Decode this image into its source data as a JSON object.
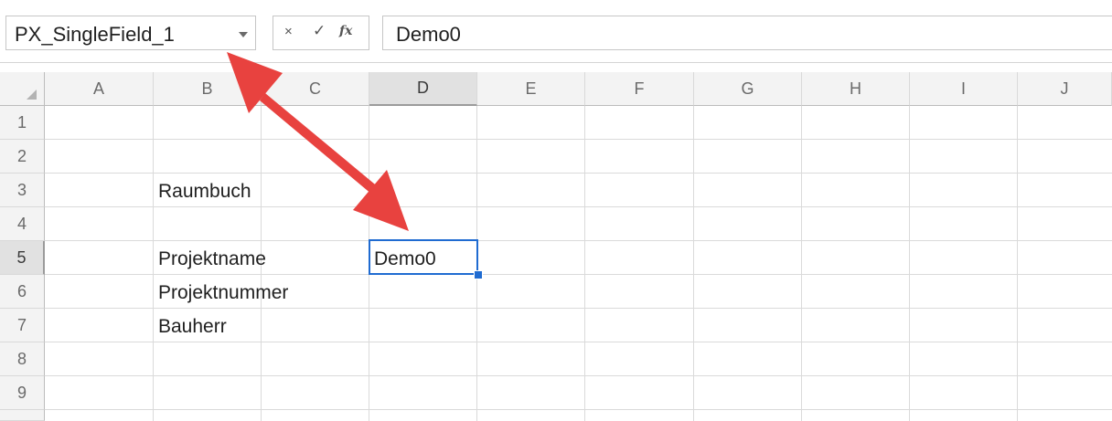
{
  "name_box": {
    "value": "PX_SingleField_1"
  },
  "formula_bar": {
    "cancel_glyph": "×",
    "enter_glyph": "✓",
    "function_glyph": "fx",
    "value": "Demo0"
  },
  "columns": [
    "A",
    "B",
    "C",
    "D",
    "E",
    "F",
    "G",
    "H",
    "I",
    "J"
  ],
  "rows": [
    "1",
    "2",
    "3",
    "4",
    "5",
    "6",
    "7",
    "8",
    "9"
  ],
  "selected": {
    "column": "D",
    "row": "5"
  },
  "cells": {
    "B3": "Raumbuch",
    "B5": "Projektname",
    "B6": "Projektnummer",
    "B7": "Bauherr",
    "D5": "Demo0"
  },
  "colors": {
    "selection": "#1f6bd1",
    "annotation_arrow": "#e8423f"
  }
}
